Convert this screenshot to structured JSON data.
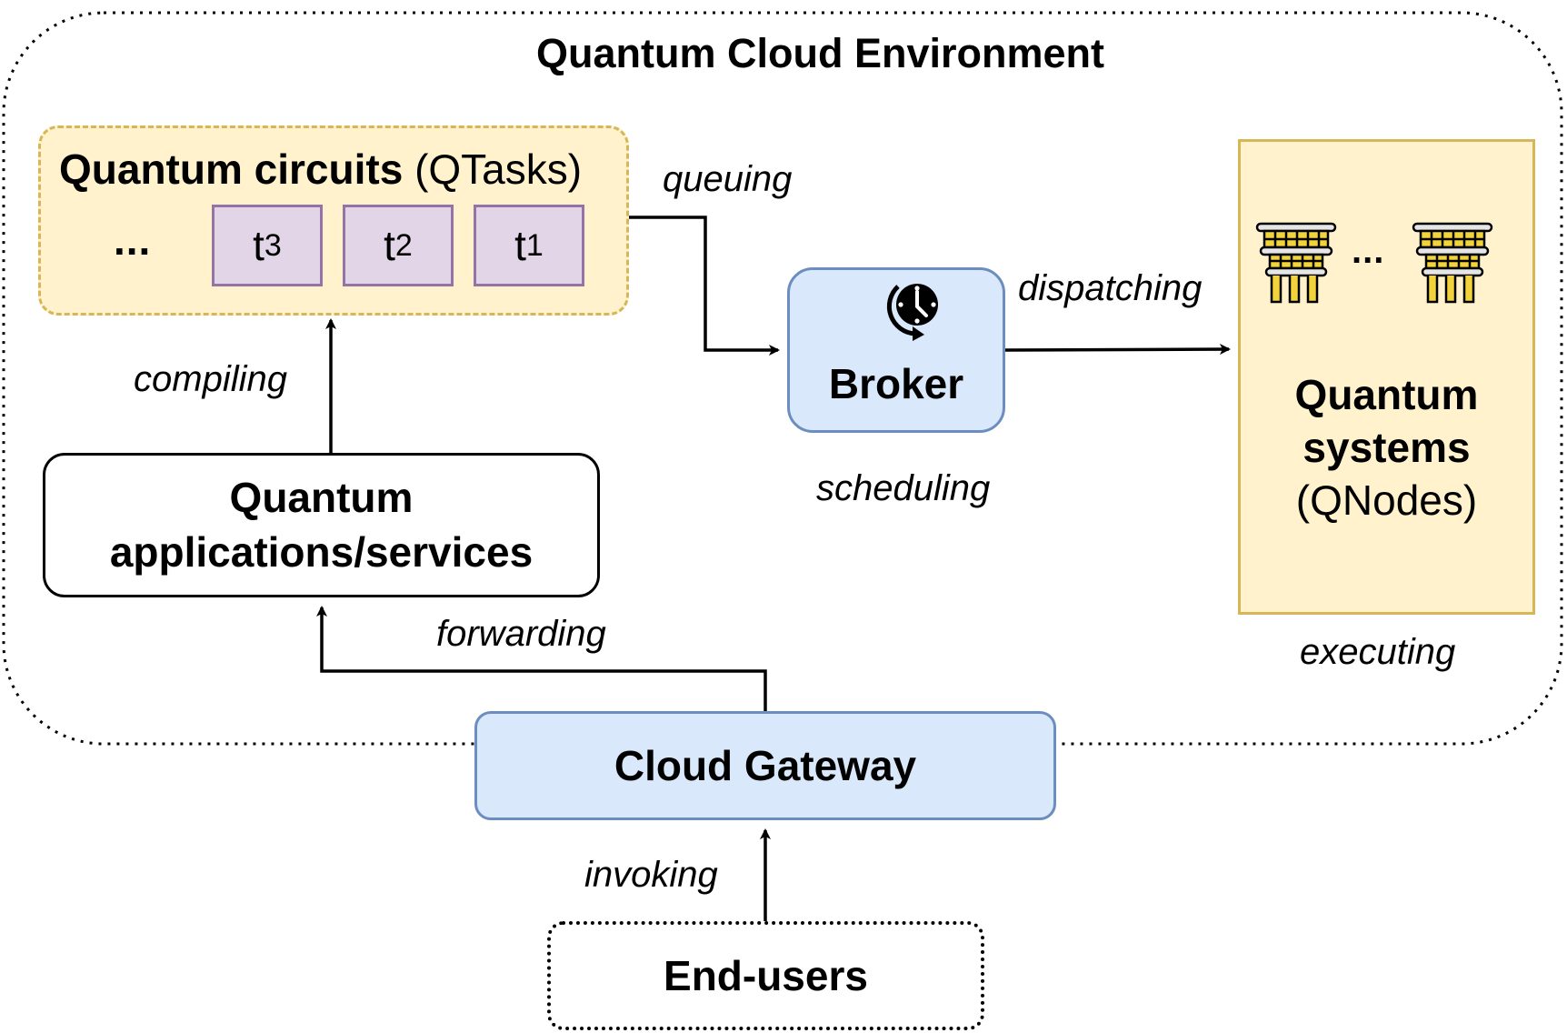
{
  "diagram": {
    "title": "Quantum Cloud Environment",
    "nodes": {
      "qtasks": {
        "title_bold": "Quantum circuits",
        "title_regular": " (QTasks)",
        "ellipsis": "...",
        "tasks": [
          {
            "label": "t",
            "sub": "3"
          },
          {
            "label": "t",
            "sub": "2"
          },
          {
            "label": "t",
            "sub": "1"
          }
        ]
      },
      "apps": {
        "line1": "Quantum",
        "line2": "applications/services"
      },
      "broker": {
        "label": "Broker",
        "icon": "clock-schedule-icon"
      },
      "qsystems": {
        "line1": "Quantum",
        "line2": "systems",
        "line3": "(QNodes)",
        "icon": "quantum-computer-icon",
        "ellipsis": "..."
      },
      "gateway": {
        "label": "Cloud Gateway"
      },
      "endusers": {
        "label": "End-users"
      }
    },
    "edge_labels": {
      "queuing": "queuing",
      "compiling": "compiling",
      "dispatching": "dispatching",
      "scheduling": "scheduling",
      "executing": "executing",
      "forwarding": "forwarding",
      "invoking": "invoking"
    },
    "colors": {
      "qtasks_fill": "#fff2cc",
      "qtasks_border": "#d6b656",
      "task_fill": "#e1d5e7",
      "task_border": "#9673a6",
      "blue_fill": "#dae8fc",
      "blue_border": "#6c8ebf",
      "icon_gold": "#f2d33b"
    }
  }
}
